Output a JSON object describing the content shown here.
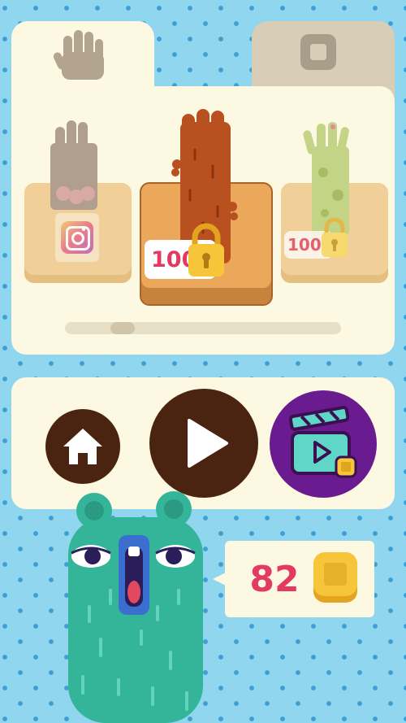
{
  "tabs": [
    {
      "name": "hands",
      "icon": "hand-icon"
    },
    {
      "name": "shapes",
      "icon": "rounded-square-icon"
    }
  ],
  "items": [
    {
      "name": "human-hand",
      "unlock": "instagram-icon"
    },
    {
      "name": "furry-brown-hand",
      "price_label": "100",
      "icon": "padlock-icon",
      "selected": true
    },
    {
      "name": "zombie-hand",
      "price_label": "100",
      "icon": "padlock-icon"
    }
  ],
  "scrollbar": {
    "position": 0.18
  },
  "buttons": {
    "home": "home-icon",
    "play": "play-icon",
    "video": "clapperboard-icon"
  },
  "coins": {
    "count": "82",
    "icon": "coin-icon"
  },
  "colors": {
    "background": "#8fd6ee",
    "panel": "#fdf8e1",
    "accent_red": "#e23a62",
    "brown": "#4a2410",
    "purple": "#6a1b8f",
    "character": "#34b59a"
  }
}
